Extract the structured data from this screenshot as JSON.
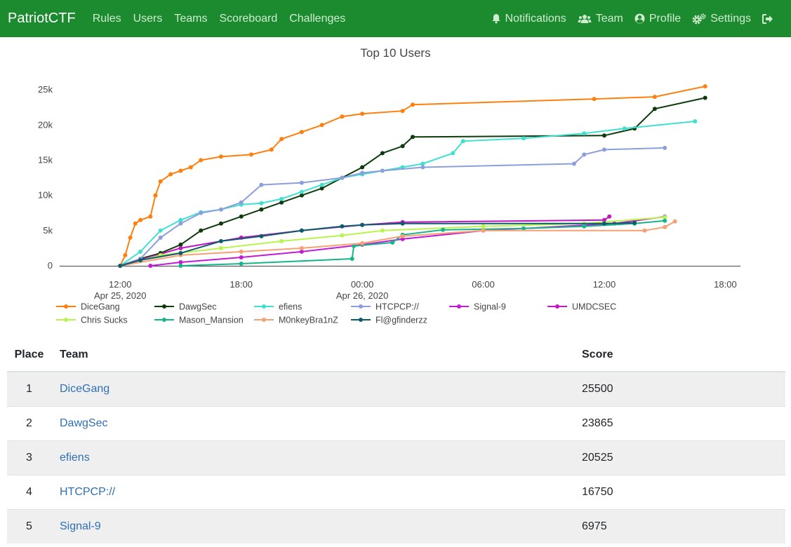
{
  "navbar": {
    "brand": "PatriotCTF",
    "links": [
      "Rules",
      "Users",
      "Teams",
      "Scoreboard",
      "Challenges"
    ],
    "right": {
      "notifications": "Notifications",
      "team": "Team",
      "profile": "Profile",
      "settings": "Settings"
    },
    "icons": {
      "notifications": "bell-icon",
      "team": "users-icon",
      "profile": "user-circle-icon",
      "settings": "cogs-icon",
      "logout": "sign-out-icon"
    }
  },
  "chart_title": "Top 10 Users",
  "chart_data": {
    "type": "line",
    "title": "Top 10 Users",
    "xlabel": "",
    "ylabel": "",
    "x_ticks": [
      "12:00\nApr 25, 2020",
      "18:00",
      "00:00\nApr 26, 2020",
      "06:00",
      "12:00",
      "18:00"
    ],
    "y_ticks": [
      "0",
      "5k",
      "10k",
      "15k",
      "20k",
      "25k"
    ],
    "ylim": [
      0,
      27000
    ],
    "legend_position": "bottom",
    "grid": false,
    "series": [
      {
        "name": "DiceGang",
        "color": "#ff7f0e",
        "points": [
          [
            "2020-04-25T12:00",
            0
          ],
          [
            "2020-04-25T12:15",
            1500
          ],
          [
            "2020-04-25T12:30",
            4000
          ],
          [
            "2020-04-25T12:45",
            6000
          ],
          [
            "2020-04-25T13:00",
            6500
          ],
          [
            "2020-04-25T13:30",
            7000
          ],
          [
            "2020-04-25T13:45",
            10000
          ],
          [
            "2020-04-25T14:00",
            12000
          ],
          [
            "2020-04-25T14:30",
            13000
          ],
          [
            "2020-04-25T15:00",
            13500
          ],
          [
            "2020-04-25T15:30",
            14000
          ],
          [
            "2020-04-25T16:00",
            15000
          ],
          [
            "2020-04-25T17:00",
            15500
          ],
          [
            "2020-04-25T18:30",
            15800
          ],
          [
            "2020-04-25T19:30",
            16500
          ],
          [
            "2020-04-25T20:00",
            18000
          ],
          [
            "2020-04-25T21:00",
            19000
          ],
          [
            "2020-04-25T22:00",
            20000
          ],
          [
            "2020-04-25T23:00",
            21200
          ],
          [
            "2020-04-26T00:00",
            21600
          ],
          [
            "2020-04-26T02:00",
            22000
          ],
          [
            "2020-04-26T02:30",
            22900
          ],
          [
            "2020-04-26T11:30",
            23700
          ],
          [
            "2020-04-26T14:30",
            24000
          ],
          [
            "2020-04-26T17:00",
            25500
          ]
        ]
      },
      {
        "name": "DawgSec",
        "color": "#0d3b0d",
        "points": [
          [
            "2020-04-25T12:00",
            0
          ],
          [
            "2020-04-25T13:00",
            1000
          ],
          [
            "2020-04-25T14:00",
            1800
          ],
          [
            "2020-04-25T15:00",
            3000
          ],
          [
            "2020-04-25T16:00",
            5000
          ],
          [
            "2020-04-25T17:00",
            6000
          ],
          [
            "2020-04-25T18:00",
            7000
          ],
          [
            "2020-04-25T19:00",
            8000
          ],
          [
            "2020-04-25T20:00",
            9000
          ],
          [
            "2020-04-25T21:00",
            10000
          ],
          [
            "2020-04-25T22:00",
            11000
          ],
          [
            "2020-04-25T23:00",
            12500
          ],
          [
            "2020-04-26T00:00",
            14000
          ],
          [
            "2020-04-26T01:00",
            16000
          ],
          [
            "2020-04-26T02:00",
            17000
          ],
          [
            "2020-04-26T02:30",
            18300
          ],
          [
            "2020-04-26T12:00",
            18500
          ],
          [
            "2020-04-26T13:30",
            19500
          ],
          [
            "2020-04-26T14:30",
            22300
          ],
          [
            "2020-04-26T17:00",
            23865
          ]
        ]
      },
      {
        "name": "efiens",
        "color": "#40e0d0",
        "points": [
          [
            "2020-04-25T12:00",
            0
          ],
          [
            "2020-04-25T13:00",
            2000
          ],
          [
            "2020-04-25T14:00",
            5000
          ],
          [
            "2020-04-25T15:00",
            6500
          ],
          [
            "2020-04-25T16:00",
            7600
          ],
          [
            "2020-04-25T17:00",
            8000
          ],
          [
            "2020-04-25T18:00",
            8700
          ],
          [
            "2020-04-25T19:00",
            8900
          ],
          [
            "2020-04-25T20:00",
            9500
          ],
          [
            "2020-04-25T21:00",
            10500
          ],
          [
            "2020-04-25T22:00",
            11500
          ],
          [
            "2020-04-25T23:00",
            12500
          ],
          [
            "2020-04-26T00:00",
            13000
          ],
          [
            "2020-04-26T01:00",
            13500
          ],
          [
            "2020-04-26T02:00",
            14000
          ],
          [
            "2020-04-26T03:00",
            14500
          ],
          [
            "2020-04-26T04:30",
            16000
          ],
          [
            "2020-04-26T05:00",
            17700
          ],
          [
            "2020-04-26T08:00",
            18100
          ],
          [
            "2020-04-26T11:00",
            18800
          ],
          [
            "2020-04-26T13:00",
            19500
          ],
          [
            "2020-04-26T16:30",
            20525
          ]
        ]
      },
      {
        "name": "HTCPCP://",
        "color": "#8c9fdc",
        "points": [
          [
            "2020-04-25T12:00",
            0
          ],
          [
            "2020-04-25T13:00",
            1000
          ],
          [
            "2020-04-25T14:00",
            4000
          ],
          [
            "2020-04-25T15:00",
            6000
          ],
          [
            "2020-04-25T16:00",
            7500
          ],
          [
            "2020-04-25T17:00",
            8000
          ],
          [
            "2020-04-25T18:00",
            9000
          ],
          [
            "2020-04-25T19:00",
            11500
          ],
          [
            "2020-04-25T21:00",
            11800
          ],
          [
            "2020-04-25T23:00",
            12500
          ],
          [
            "2020-04-26T00:00",
            13200
          ],
          [
            "2020-04-26T01:00",
            13500
          ],
          [
            "2020-04-26T03:00",
            14000
          ],
          [
            "2020-04-26T10:30",
            14500
          ],
          [
            "2020-04-26T11:00",
            15800
          ],
          [
            "2020-04-26T12:00",
            16500
          ],
          [
            "2020-04-26T15:00",
            16750
          ]
        ]
      },
      {
        "name": "Signal-9",
        "color": "#c21bd6",
        "points": [
          [
            "2020-04-25T13:30",
            0
          ],
          [
            "2020-04-25T15:00",
            500
          ],
          [
            "2020-04-25T18:00",
            1200
          ],
          [
            "2020-04-25T21:00",
            2000
          ],
          [
            "2020-04-26T00:00",
            3000
          ],
          [
            "2020-04-26T02:00",
            3800
          ],
          [
            "2020-04-26T06:00",
            5000
          ],
          [
            "2020-04-26T12:30",
            6000
          ],
          [
            "2020-04-26T15:00",
            6975
          ]
        ]
      },
      {
        "name": "UMDCSEC",
        "color": "#c217c2",
        "points": [
          [
            "2020-04-25T12:00",
            0
          ],
          [
            "2020-04-25T15:00",
            2500
          ],
          [
            "2020-04-25T18:00",
            4000
          ],
          [
            "2020-04-25T21:00",
            5000
          ],
          [
            "2020-04-26T00:00",
            5800
          ],
          [
            "2020-04-26T02:00",
            6200
          ],
          [
            "2020-04-26T12:00",
            6500
          ],
          [
            "2020-04-26T12:15",
            7000
          ]
        ]
      },
      {
        "name": "Chris Sucks",
        "color": "#b8f54a",
        "points": [
          [
            "2020-04-25T12:00",
            0
          ],
          [
            "2020-04-25T14:00",
            1500
          ],
          [
            "2020-04-25T17:00",
            2500
          ],
          [
            "2020-04-25T20:00",
            3500
          ],
          [
            "2020-04-25T23:00",
            4300
          ],
          [
            "2020-04-26T01:00",
            5000
          ],
          [
            "2020-04-26T06:00",
            5600
          ],
          [
            "2020-04-26T11:00",
            6000
          ],
          [
            "2020-04-26T15:00",
            6900
          ]
        ]
      },
      {
        "name": "Mason_Mansion",
        "color": "#17b58a",
        "points": [
          [
            "2020-04-25T15:00",
            0
          ],
          [
            "2020-04-25T18:00",
            300
          ],
          [
            "2020-04-25T23:30",
            1000
          ],
          [
            "2020-04-25T23:35",
            2800
          ],
          [
            "2020-04-26T01:30",
            3300
          ],
          [
            "2020-04-26T02:00",
            4400
          ],
          [
            "2020-04-26T04:00",
            5100
          ],
          [
            "2020-04-26T08:00",
            5300
          ],
          [
            "2020-04-26T11:00",
            5600
          ],
          [
            "2020-04-26T13:30",
            6000
          ],
          [
            "2020-04-26T15:00",
            6400
          ]
        ]
      },
      {
        "name": "M0nkeyBra1nZ",
        "color": "#f7a073",
        "points": [
          [
            "2020-04-25T12:00",
            0
          ],
          [
            "2020-04-25T15:00",
            1500
          ],
          [
            "2020-04-25T18:00",
            2000
          ],
          [
            "2020-04-25T21:00",
            2500
          ],
          [
            "2020-04-26T00:00",
            3200
          ],
          [
            "2020-04-26T02:00",
            4200
          ],
          [
            "2020-04-26T06:00",
            5000
          ],
          [
            "2020-04-26T14:00",
            5000
          ],
          [
            "2020-04-26T15:00",
            5500
          ],
          [
            "2020-04-26T15:30",
            6300
          ]
        ]
      },
      {
        "name": "Fl@gfinderzz",
        "color": "#0d5c6b",
        "points": [
          [
            "2020-04-25T12:00",
            0
          ],
          [
            "2020-04-25T13:00",
            800
          ],
          [
            "2020-04-25T15:00",
            1800
          ],
          [
            "2020-04-25T17:00",
            3500
          ],
          [
            "2020-04-25T19:00",
            4200
          ],
          [
            "2020-04-25T21:00",
            5000
          ],
          [
            "2020-04-25T23:00",
            5600
          ],
          [
            "2020-04-26T00:00",
            5800
          ],
          [
            "2020-04-26T02:00",
            6000
          ],
          [
            "2020-04-26T12:00",
            6000
          ],
          [
            "2020-04-26T13:30",
            6100
          ]
        ]
      }
    ]
  },
  "table": {
    "headers": [
      "Place",
      "Team",
      "Score"
    ],
    "rows": [
      {
        "place": "1",
        "team": "DiceGang",
        "score": "25500"
      },
      {
        "place": "2",
        "team": "DawgSec",
        "score": "23865"
      },
      {
        "place": "3",
        "team": "efiens",
        "score": "20525"
      },
      {
        "place": "4",
        "team": "HTCPCP://",
        "score": "16750"
      },
      {
        "place": "5",
        "team": "Signal-9",
        "score": "6975"
      }
    ]
  }
}
